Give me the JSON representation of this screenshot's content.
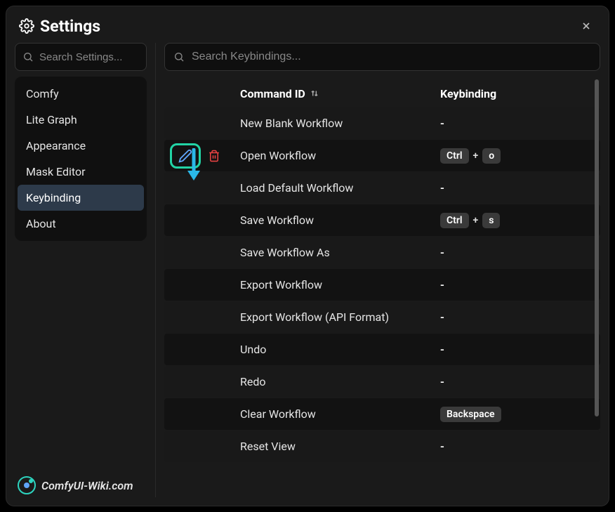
{
  "header": {
    "title": "Settings"
  },
  "sidebar": {
    "search_placeholder": "Search Settings...",
    "items": [
      {
        "label": "Comfy",
        "active": false
      },
      {
        "label": "Lite Graph",
        "active": false
      },
      {
        "label": "Appearance",
        "active": false
      },
      {
        "label": "Mask Editor",
        "active": false
      },
      {
        "label": "Keybinding",
        "active": true
      },
      {
        "label": "About",
        "active": false
      }
    ]
  },
  "main": {
    "search_placeholder": "Search Keybindings...",
    "columns": {
      "command": "Command ID",
      "keybinding": "Keybinding"
    },
    "rows": [
      {
        "command": "New Blank Workflow",
        "keys": [],
        "unset": "-",
        "edit": false,
        "zebra": false
      },
      {
        "command": "Open Workflow",
        "keys": [
          "Ctrl",
          "o"
        ],
        "unset": "",
        "edit": true,
        "zebra": true
      },
      {
        "command": "Load Default Workflow",
        "keys": [],
        "unset": "-",
        "edit": false,
        "zebra": false
      },
      {
        "command": "Save Workflow",
        "keys": [
          "Ctrl",
          "s"
        ],
        "unset": "",
        "edit": false,
        "zebra": true
      },
      {
        "command": "Save Workflow As",
        "keys": [],
        "unset": "-",
        "edit": false,
        "zebra": false
      },
      {
        "command": "Export Workflow",
        "keys": [],
        "unset": "-",
        "edit": false,
        "zebra": true
      },
      {
        "command": "Export Workflow (API Format)",
        "keys": [],
        "unset": "-",
        "edit": false,
        "zebra": false
      },
      {
        "command": "Undo",
        "keys": [],
        "unset": "-",
        "edit": false,
        "zebra": true
      },
      {
        "command": "Redo",
        "keys": [],
        "unset": "-",
        "edit": false,
        "zebra": false
      },
      {
        "command": "Clear Workflow",
        "keys": [
          "Backspace"
        ],
        "unset": "",
        "edit": false,
        "zebra": true
      },
      {
        "command": "Reset View",
        "keys": [],
        "unset": "-",
        "edit": false,
        "zebra": false
      }
    ]
  },
  "footer": {
    "brand": "ComfyUI-Wiki.com"
  },
  "colors": {
    "highlight": "#22d3a5",
    "arrow": "#2ab8e8",
    "danger": "#ef4444"
  }
}
